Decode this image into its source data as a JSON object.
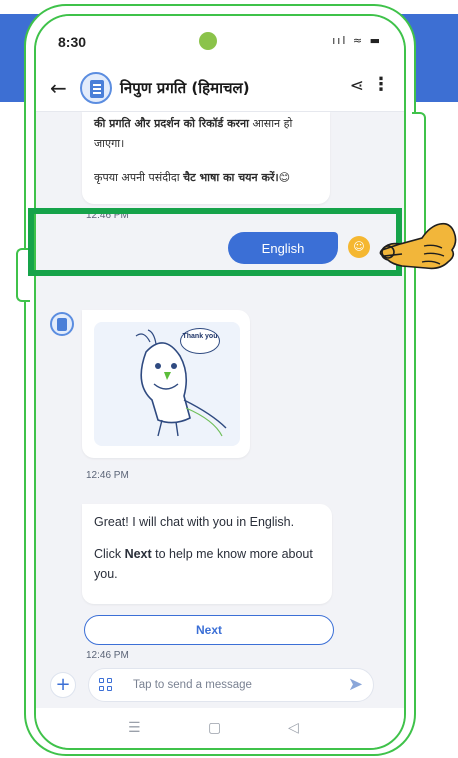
{
  "status": {
    "time": "8:30",
    "icons": "ııl ≈ ▬"
  },
  "appbar": {
    "title": "निपुण प्रगति (हिमाचल)"
  },
  "messages": {
    "top_line1_bold": "की प्रगति और प्रदर्शन को रिकॉर्ड करना",
    "top_line1_rest": " आसान हो",
    "top_line2": "जाएगा।",
    "top_line3_pre": "कृपया अपनी पसंदीदा ",
    "top_line3_bold": "चैट भाषा का चयन करें।",
    "top_emoji": "😊",
    "time_1": "12:46 PM",
    "user_reply": "English",
    "sticker_text": "Thank you",
    "time_2": "12:46 PM",
    "great_line": "Great! I will chat with you in English.",
    "click_pre": "Click ",
    "click_bold": "Next",
    "click_post": " to help me know more about you.",
    "next_button": "Next",
    "time_3": "12:46 PM"
  },
  "composer": {
    "placeholder": "Tap to send a message"
  },
  "icons": {
    "back": "arrow-left-icon",
    "share": "share-icon",
    "more": "more-vertical-icon",
    "plus": "plus-icon",
    "grid": "grid-icon",
    "send": "send-icon",
    "nav_menu": "menu-icon",
    "nav_home": "home-icon",
    "nav_back": "back-triangle-icon",
    "pointer": "pointing-hand-icon"
  },
  "colors": {
    "accent": "#3b6fd6",
    "highlight": "#16a34a",
    "phone_outline": "#3fc24a",
    "user_avatar": "#f5b731"
  }
}
